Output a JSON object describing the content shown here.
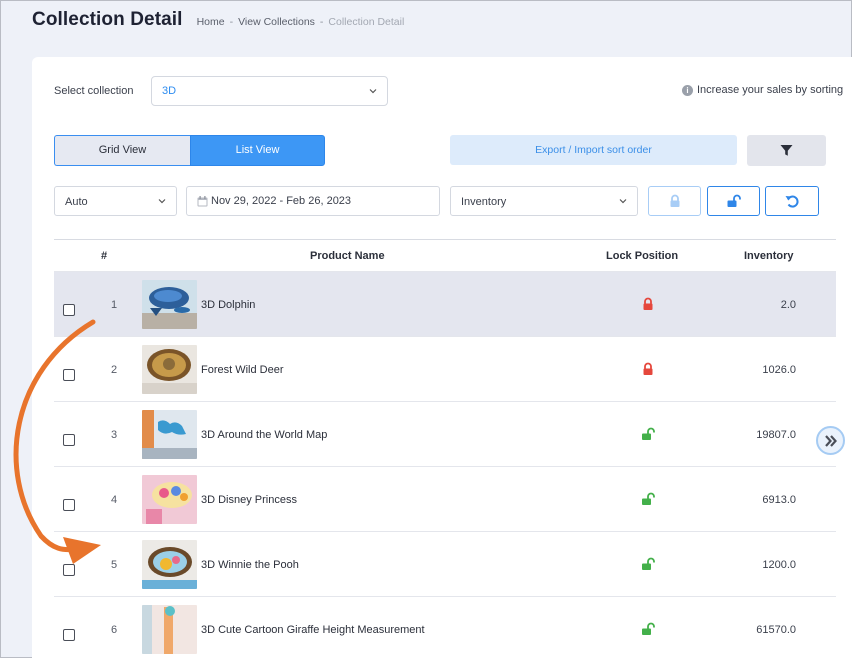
{
  "header": {
    "title": "Collection Detail",
    "breadcrumb": [
      "Home",
      "View Collections",
      "Collection Detail"
    ],
    "separator": "-"
  },
  "controls": {
    "select_label": "Select collection",
    "collection_value": "3D",
    "hint_text": "Increase your sales by sorting",
    "info_icon": "i",
    "grid_view_label": "Grid View",
    "list_view_label": "List View",
    "export_label": "Export / Import sort order",
    "filter_icon": "filter-icon",
    "auto_value": "Auto",
    "date_range": "Nov 29, 2022 - Feb 26, 2023",
    "sort_value": "Inventory"
  },
  "table": {
    "headers": {
      "index": "#",
      "product": "Product Name",
      "lock": "Lock Position",
      "inventory": "Inventory"
    },
    "rows": [
      {
        "index": "1",
        "name": "3D Dolphin",
        "locked": true,
        "inventory": "2.0"
      },
      {
        "index": "2",
        "name": "Forest Wild Deer",
        "locked": true,
        "inventory": "1026.0"
      },
      {
        "index": "3",
        "name": "3D Around the World Map",
        "locked": false,
        "inventory": "19807.0"
      },
      {
        "index": "4",
        "name": "3D Disney Princess",
        "locked": false,
        "inventory": "6913.0"
      },
      {
        "index": "5",
        "name": "3D Winnie the Pooh",
        "locked": false,
        "inventory": "1200.0"
      },
      {
        "index": "6",
        "name": "3D Cute Cartoon Giraffe Height Measurement",
        "locked": false,
        "inventory": "61570.0"
      }
    ]
  },
  "colors": {
    "accent": "#3d97f5",
    "locked": "#e5473c",
    "unlocked": "#43b04a",
    "arrow": "#e8742c"
  }
}
